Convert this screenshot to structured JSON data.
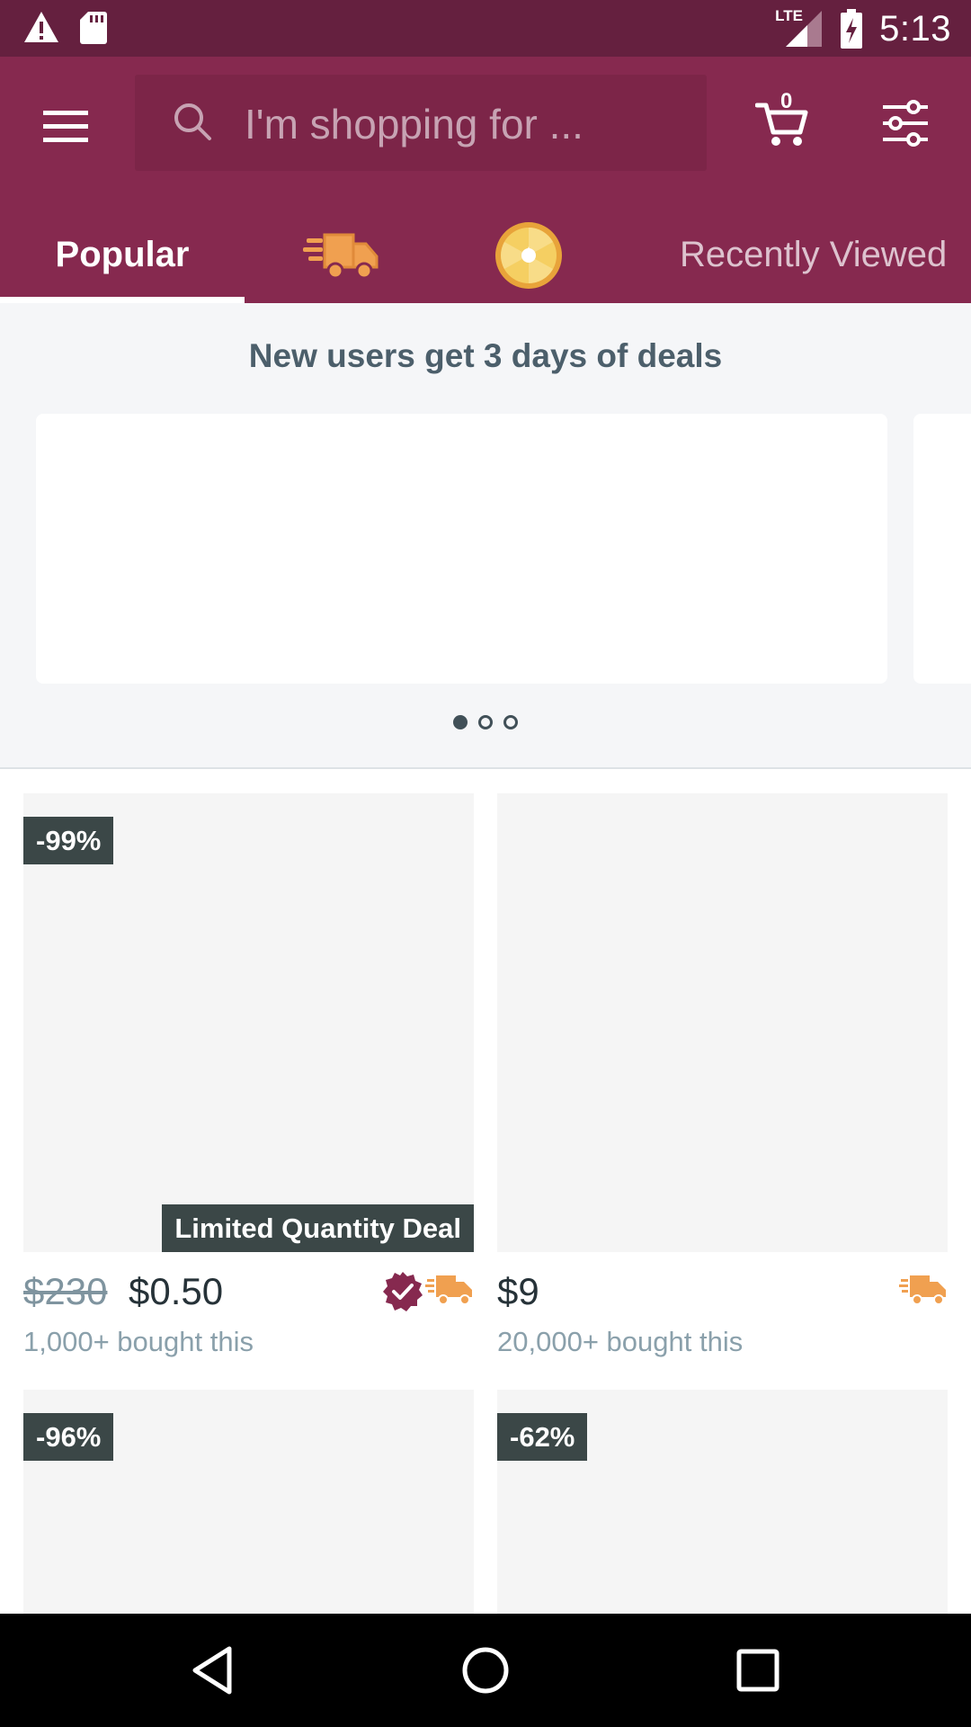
{
  "status_bar": {
    "time": "5:13",
    "network": "LTE",
    "icons": [
      "warning-icon",
      "sd-card-icon",
      "lte-signal-icon",
      "battery-charging-icon"
    ]
  },
  "app_bar": {
    "search_placeholder": "I'm shopping for ...",
    "cart_count": "0",
    "icons": [
      "menu-icon",
      "search-icon",
      "cart-icon",
      "filter-icon"
    ]
  },
  "tabs": [
    {
      "label": "Popular",
      "selected": true
    },
    {
      "label": "",
      "icon": "express-truck-icon"
    },
    {
      "label": "",
      "icon": "prize-wheel-icon"
    },
    {
      "label": "Recently Viewed"
    }
  ],
  "promo": {
    "title": "New users get 3 days of deals",
    "dots": 3,
    "active_dot": 0
  },
  "products": [
    {
      "discount": "-99%",
      "tag": "Limited Quantity Deal",
      "old_price": "$230",
      "price": "$0.50",
      "bought": "1,000+ bought this",
      "verified": true,
      "express": true
    },
    {
      "discount": "",
      "tag": "",
      "old_price": "",
      "price": "$9",
      "bought": "20,000+ bought this",
      "verified": false,
      "express": true
    },
    {
      "discount": "-96%"
    },
    {
      "discount": "-62%"
    }
  ],
  "colors": {
    "status_bar": "#65203f",
    "app_bar": "#86294f",
    "badge": "#3b4747",
    "express_orange": "#f0a050",
    "verified": "#86294f"
  },
  "nav_bar": {
    "icons": [
      "back-icon",
      "home-icon",
      "recents-icon"
    ]
  }
}
